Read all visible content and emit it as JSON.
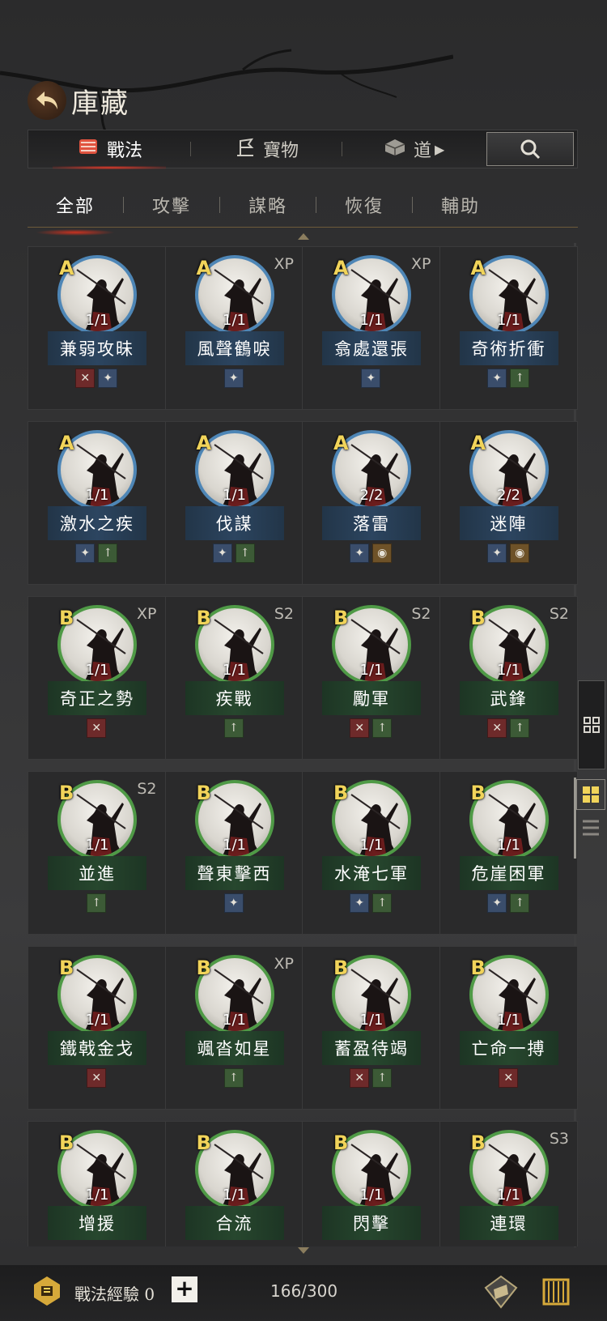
{
  "header": {
    "title": "庫藏"
  },
  "top_tabs": [
    {
      "label": "戰法",
      "icon": "scroll-bundle-icon",
      "active": true
    },
    {
      "label": "寶物",
      "icon": "treasure-flag-icon",
      "active": false
    },
    {
      "label": "道",
      "icon": "item-box-icon",
      "active": false
    }
  ],
  "sub_tabs": [
    {
      "label": "全部",
      "active": true
    },
    {
      "label": "攻擊",
      "active": false
    },
    {
      "label": "謀略",
      "active": false
    },
    {
      "label": "恢復",
      "active": false
    },
    {
      "label": "輔助",
      "active": false
    }
  ],
  "tactics": [
    {
      "grade": "A",
      "tag": "",
      "count": "1/1",
      "name": "兼弱攻昧",
      "badges": [
        "attack",
        "strategy"
      ]
    },
    {
      "grade": "A",
      "tag": "XP",
      "count": "1/1",
      "name": "風聲鶴唳",
      "badges": [
        "strategy"
      ]
    },
    {
      "grade": "A",
      "tag": "XP",
      "count": "1/1",
      "name": "翕處還張",
      "badges": [
        "strategy"
      ]
    },
    {
      "grade": "A",
      "tag": "",
      "count": "1/1",
      "name": "奇術折衝",
      "badges": [
        "strategy",
        "heal"
      ]
    },
    {
      "grade": "A",
      "tag": "",
      "count": "1/1",
      "name": "激水之疾",
      "badges": [
        "strategy",
        "heal"
      ]
    },
    {
      "grade": "A",
      "tag": "",
      "count": "1/1",
      "name": "伐謀",
      "badges": [
        "strategy",
        "heal"
      ]
    },
    {
      "grade": "A",
      "tag": "",
      "count": "2/2",
      "name": "落雷",
      "badges": [
        "strategy",
        "control"
      ]
    },
    {
      "grade": "A",
      "tag": "",
      "count": "2/2",
      "name": "迷陣",
      "badges": [
        "strategy",
        "control"
      ]
    },
    {
      "grade": "B",
      "tag": "XP",
      "count": "1/1",
      "name": "奇正之勢",
      "badges": [
        "attack"
      ]
    },
    {
      "grade": "B",
      "tag": "S2",
      "count": "1/1",
      "name": "疾戰",
      "badges": [
        "heal"
      ]
    },
    {
      "grade": "B",
      "tag": "S2",
      "count": "1/1",
      "name": "勵軍",
      "badges": [
        "attack",
        "heal"
      ]
    },
    {
      "grade": "B",
      "tag": "S2",
      "count": "1/1",
      "name": "武鋒",
      "badges": [
        "attack",
        "heal"
      ]
    },
    {
      "grade": "B",
      "tag": "S2",
      "count": "1/1",
      "name": "並進",
      "badges": [
        "heal"
      ]
    },
    {
      "grade": "B",
      "tag": "",
      "count": "1/1",
      "name": "聲東擊西",
      "badges": [
        "strategy"
      ]
    },
    {
      "grade": "B",
      "tag": "",
      "count": "1/1",
      "name": "水淹七軍",
      "badges": [
        "strategy",
        "heal"
      ]
    },
    {
      "grade": "B",
      "tag": "",
      "count": "1/1",
      "name": "危崖困軍",
      "badges": [
        "strategy",
        "heal"
      ]
    },
    {
      "grade": "B",
      "tag": "",
      "count": "1/1",
      "name": "鐵戟金戈",
      "badges": [
        "attack"
      ]
    },
    {
      "grade": "B",
      "tag": "XP",
      "count": "1/1",
      "name": "颯沓如星",
      "badges": [
        "heal"
      ]
    },
    {
      "grade": "B",
      "tag": "",
      "count": "1/1",
      "name": "蓄盈待竭",
      "badges": [
        "attack",
        "heal"
      ]
    },
    {
      "grade": "B",
      "tag": "",
      "count": "1/1",
      "name": "亡命一搏",
      "badges": [
        "attack"
      ]
    },
    {
      "grade": "B",
      "tag": "",
      "count": "1/1",
      "name": "增援",
      "badges": []
    },
    {
      "grade": "B",
      "tag": "",
      "count": "1/1",
      "name": "合流",
      "badges": []
    },
    {
      "grade": "B",
      "tag": "",
      "count": "1/1",
      "name": "閃擊",
      "badges": []
    },
    {
      "grade": "B",
      "tag": "S3",
      "count": "1/1",
      "name": "連環",
      "badges": []
    }
  ],
  "footer": {
    "exp_label": "戰法經驗 0",
    "plus_label": "+",
    "capacity": "166/300"
  },
  "colors": {
    "grade_a_ring": "#4e86b6",
    "grade_b_ring": "#4f9a46",
    "grade_letter": "#f1d45a",
    "active_underline": "#e23b2a"
  }
}
